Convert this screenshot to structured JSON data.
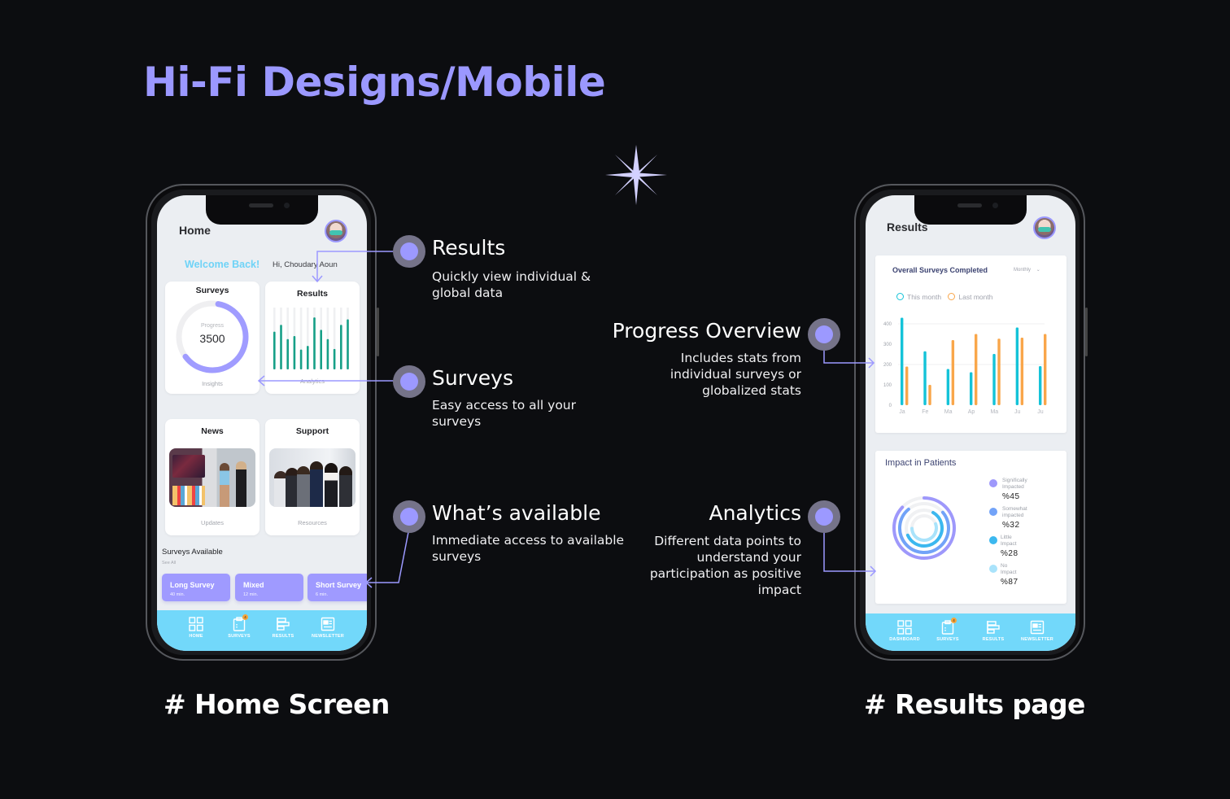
{
  "page": {
    "title": "Hi-Fi Designs/Mobile",
    "decor_icon": "sparkle-icon",
    "accent_color": "#9b98ff"
  },
  "home": {
    "caption": "# Home Screen",
    "header_title": "Home",
    "welcome": "Welcome Back!",
    "greeting": "Hi, Choudary Aoun",
    "cards": {
      "surveys": {
        "title": "Surveys",
        "progress_label": "Progress",
        "progress_value": "3500",
        "progress_fraction": 0.62,
        "subtitle": "Insights"
      },
      "results": {
        "title": "Results",
        "subtitle": "Analytics",
        "bar_levels": [
          0.61,
          0.72,
          0.49,
          0.54,
          0.32,
          0.38,
          0.84,
          0.64,
          0.49,
          0.33,
          0.72,
          0.81
        ]
      },
      "news": {
        "title": "News",
        "subtitle": "Updates"
      },
      "support": {
        "title": "Support",
        "subtitle": "Resources"
      }
    },
    "surveys_available": {
      "title": "Surveys Available",
      "see_all": "See All",
      "items": [
        {
          "name": "Long Survey",
          "time": "40 min."
        },
        {
          "name": "Mixed",
          "time": "12 min."
        },
        {
          "name": "Short Survey",
          "time": "6 min."
        }
      ]
    },
    "tabbar": [
      {
        "label": "HOME",
        "icon": "grid-icon"
      },
      {
        "label": "SURVEYS",
        "icon": "clipboard-icon",
        "badge": "4"
      },
      {
        "label": "RESULTS",
        "icon": "results-icon"
      },
      {
        "label": "NEWSLETTER",
        "icon": "newsletter-icon"
      }
    ]
  },
  "results_page": {
    "caption": "# Results page",
    "header_title": "Results",
    "overall": {
      "title": "Overall Surveys Completed",
      "period": "Monthly",
      "legend": [
        {
          "label": "This month",
          "color": "#14c3d8"
        },
        {
          "label": "Last month",
          "color": "#f9a64a"
        }
      ]
    },
    "impact": {
      "title": "Impact in Patients",
      "items": [
        {
          "label_line1": "Significally",
          "label_line2": "Impacted",
          "value": "%45",
          "color": "#9e98fb"
        },
        {
          "label_line1": "Somewhat",
          "label_line2": "impacted",
          "value": "%32",
          "color": "#72a3f8"
        },
        {
          "label_line1": "Little",
          "label_line2": "Impact",
          "value": "%28",
          "color": "#3cb8ef"
        },
        {
          "label_line1": "No",
          "label_line2": "Impact",
          "value": "%87",
          "color": "#a9e3fb"
        }
      ]
    },
    "tabbar": [
      {
        "label": "DASHBOARD",
        "icon": "grid-icon"
      },
      {
        "label": "SURVEYS",
        "icon": "clipboard-icon",
        "badge": "4"
      },
      {
        "label": "RESULTS",
        "icon": "results-icon"
      },
      {
        "label": "NEWSLETTER",
        "icon": "newsletter-icon"
      }
    ]
  },
  "callouts": {
    "results": {
      "title": "Results",
      "text": "Quickly view individual & global data"
    },
    "surveys": {
      "title": "Surveys",
      "text": "Easy access to all your surveys"
    },
    "available": {
      "title": "What’s available",
      "text": "Immediate access to available surveys"
    },
    "progress": {
      "title": "Progress Overview",
      "text": "Includes stats from individual surveys or globalized stats"
    },
    "analytics": {
      "title": "Analytics",
      "text": "Different data points to understand your participation as positive impact"
    }
  },
  "chart_data": [
    {
      "type": "bar",
      "title": "Overall Surveys Completed",
      "categories": [
        "Ja",
        "Fe",
        "Ma",
        "Ap",
        "Ma",
        "Ju",
        "Ju"
      ],
      "series": [
        {
          "name": "This month",
          "color": "#14c3d8",
          "values": [
            430,
            265,
            178,
            162,
            252,
            382,
            192
          ]
        },
        {
          "name": "Last month",
          "color": "#f9a64a",
          "values": [
            190,
            100,
            320,
            350,
            327,
            332,
            350
          ]
        }
      ],
      "yticks": [
        0,
        100,
        200,
        300,
        400
      ],
      "ylim": [
        0,
        440
      ],
      "xlabel": "",
      "ylabel": "",
      "grid": true,
      "legend": "top-left"
    },
    {
      "type": "pie",
      "title": "Impact in Patients",
      "style": "concentric-rings",
      "categories": [
        "Significally Impacted",
        "Somewhat impacted",
        "Little Impact",
        "No Impact"
      ],
      "values": [
        87,
        75,
        60,
        55
      ]
    }
  ]
}
